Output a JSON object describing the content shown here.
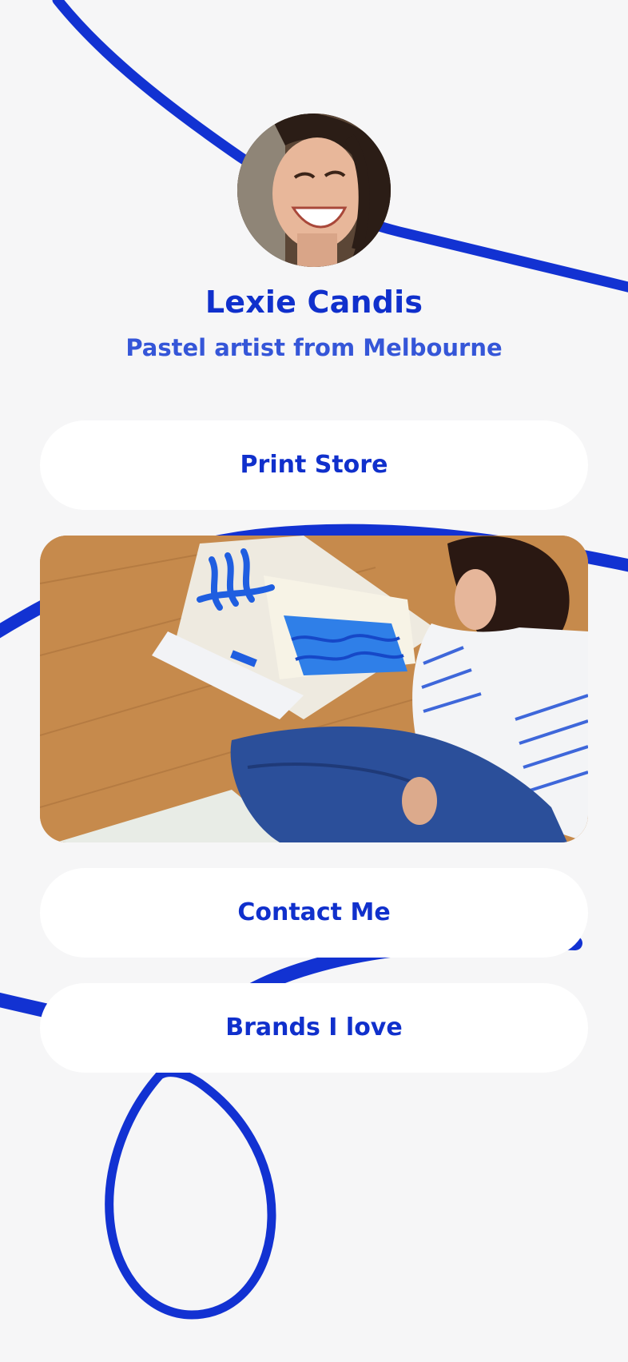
{
  "profile": {
    "name": "Lexie Candis",
    "bio": "Pastel artist from Melbourne",
    "avatar_icon": "portrait-photo"
  },
  "links": [
    {
      "label": "Print Store"
    },
    {
      "label": "Contact Me"
    },
    {
      "label": "Brands I love"
    }
  ],
  "feature_image": {
    "icon": "artist-painting-photo"
  },
  "colors": {
    "background": "#f6f6f7",
    "accent": "#1030cc",
    "subtitle": "#3556d8",
    "button_bg": "#ffffff"
  }
}
